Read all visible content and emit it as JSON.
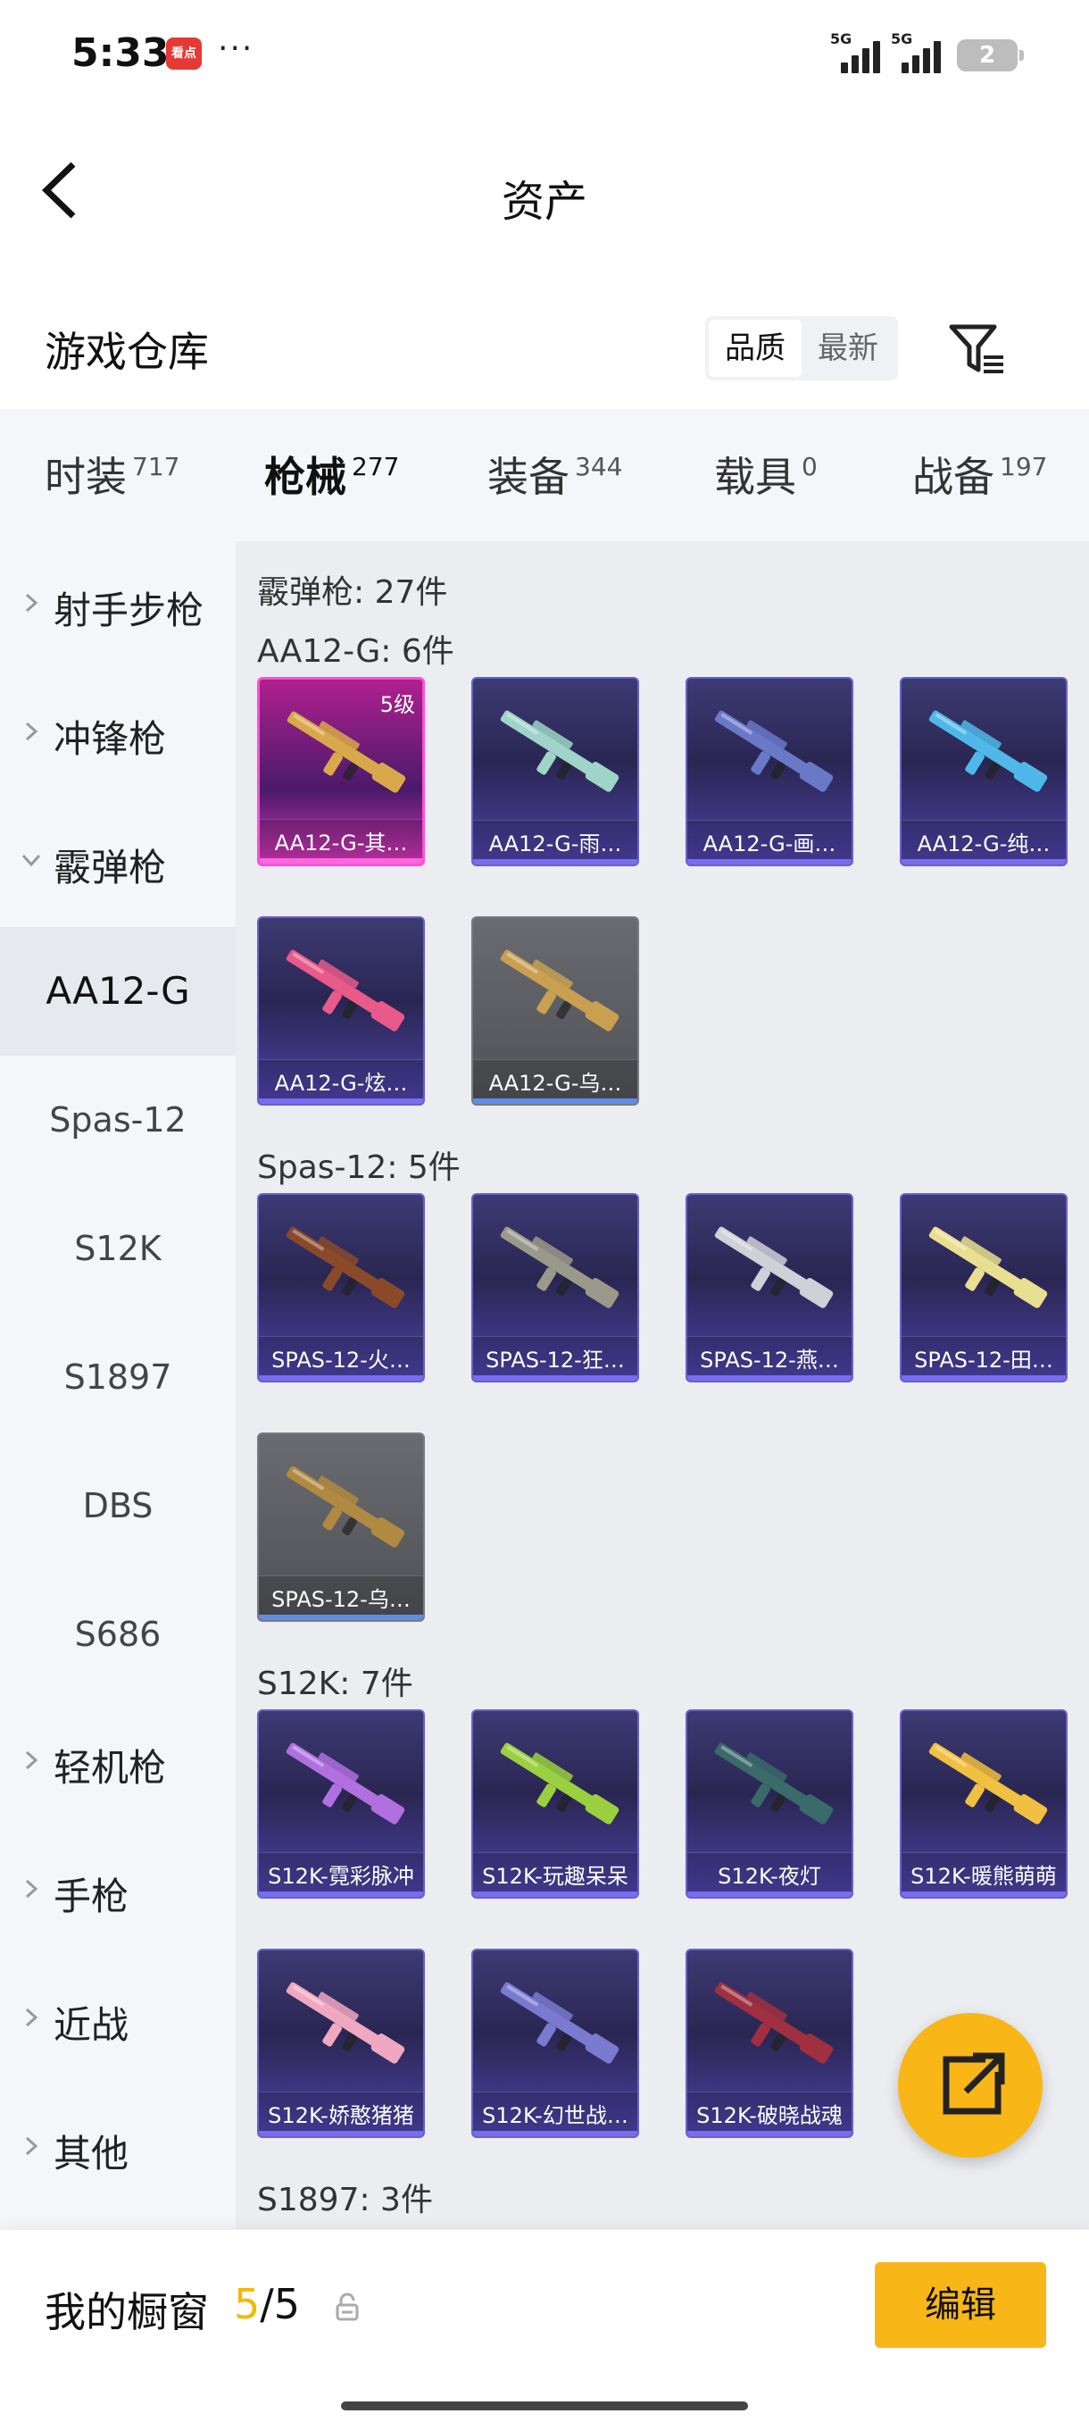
{
  "status": {
    "time": "5:33",
    "app_icon_text": "看点",
    "more": "···",
    "sig1": "5G",
    "sig2": "5G",
    "battery": "2"
  },
  "header": {
    "title": "资产"
  },
  "warehouse": {
    "title": "游戏仓库",
    "sort_quality": "品质",
    "sort_newest": "最新"
  },
  "tabs": [
    {
      "label": "时装",
      "count": "717"
    },
    {
      "label": "枪械",
      "count": "277"
    },
    {
      "label": "装备",
      "count": "344"
    },
    {
      "label": "载具",
      "count": "0"
    },
    {
      "label": "战备",
      "count": "197"
    }
  ],
  "sidebar": {
    "groups": [
      {
        "label": "射手步枪"
      },
      {
        "label": "冲锋枪"
      },
      {
        "label": "霰弹枪"
      }
    ],
    "subs": [
      "AA12-G",
      "Spas-12",
      "S12K",
      "S1897",
      "DBS",
      "S686"
    ],
    "groups2": [
      {
        "label": "轻机枪"
      },
      {
        "label": "手枪"
      },
      {
        "label": "近战"
      },
      {
        "label": "其他"
      }
    ]
  },
  "content": {
    "category_header": "霰弹枪: 27件",
    "sections": [
      {
        "label": "AA12-G: 6件",
        "items": [
          {
            "name": "AA12-G-其…",
            "level": "5级",
            "style": "pink",
            "gun": "#d8a84a"
          },
          {
            "name": "AA12-G-雨…",
            "style": "purple",
            "gun": "#9fd4c8"
          },
          {
            "name": "AA12-G-画…",
            "style": "purple",
            "gun": "#6a78c8"
          },
          {
            "name": "AA12-G-纯…",
            "style": "purple",
            "gun": "#4fb8e8"
          },
          {
            "name": "AA12-G-炫…",
            "style": "purple",
            "gun": "#e85a8a"
          },
          {
            "name": "AA12-G-乌…",
            "style": "gray",
            "gun": "#c8a050"
          }
        ]
      },
      {
        "label": "Spas-12: 5件",
        "items": [
          {
            "name": "SPAS-12-火…",
            "style": "purple",
            "gun": "#8a4a2a"
          },
          {
            "name": "SPAS-12-狂…",
            "style": "purple",
            "gun": "#9a9a8a"
          },
          {
            "name": "SPAS-12-燕…",
            "style": "purple",
            "gun": "#d0d0d8"
          },
          {
            "name": "SPAS-12-田…",
            "style": "purple",
            "gun": "#e8e090"
          },
          {
            "name": "SPAS-12-乌…",
            "style": "gray",
            "gun": "#b08a40"
          }
        ]
      },
      {
        "label": "S12K: 7件",
        "items": [
          {
            "name": "S12K-霓彩脉冲",
            "style": "purple",
            "gun": "#b070e0"
          },
          {
            "name": "S12K-玩趣呆呆",
            "style": "purple",
            "gun": "#9ad040"
          },
          {
            "name": "S12K-夜灯",
            "style": "purple",
            "gun": "#3a6a6a"
          },
          {
            "name": "S12K-暖熊萌萌",
            "style": "purple",
            "gun": "#f0c040"
          },
          {
            "name": "S12K-娇憨猪猪",
            "style": "purple",
            "gun": "#f0a8c0"
          },
          {
            "name": "S12K-幻世战…",
            "style": "purple",
            "gun": "#7a7ad0"
          },
          {
            "name": "S12K-破晓战魂",
            "style": "purple",
            "gun": "#a03040"
          }
        ]
      },
      {
        "label": "S1897: 3件",
        "items": []
      }
    ]
  },
  "bottom": {
    "title": "我的橱窗",
    "current": "5",
    "total": "/5",
    "edit": "编辑"
  }
}
